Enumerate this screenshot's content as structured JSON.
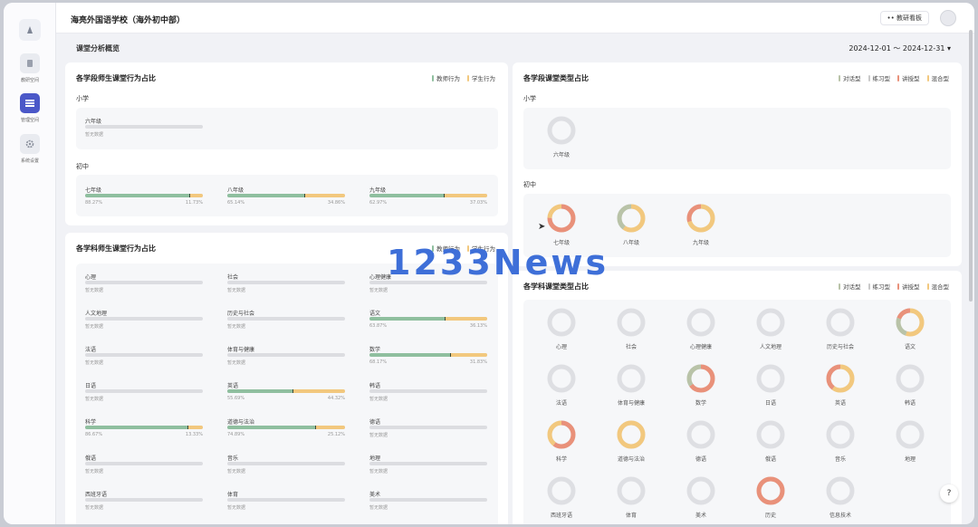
{
  "app": {
    "school_name": "海亮外国语学校（海外初中部）",
    "header_button": "教研看板",
    "page_title": "课堂分析概览",
    "date_range": "2024-12-01 ～ 2024-12-31 ▾",
    "help": "?"
  },
  "sidebar": {
    "items": [
      {
        "label": "教研空间",
        "icon": "book-icon"
      },
      {
        "label": "管理空间",
        "icon": "grid-icon",
        "active": true
      },
      {
        "label": "系统设置",
        "icon": "gear-icon"
      }
    ]
  },
  "colors": {
    "teacher": "#8fbf9f",
    "student": "#f2c87e",
    "dialog": "#b9c3a8",
    "practice": "#c9c9c9",
    "lecture": "#e9917a",
    "mixed": "#f2c87e",
    "accent": "#4b58c8"
  },
  "stage_behavior": {
    "title": "各学段师生课堂行为占比",
    "legend": {
      "teacher": "教师行为",
      "student": "学生行为"
    },
    "primary_label": "小学",
    "primary": [
      {
        "name": "六年级",
        "pct": "暂无数据"
      }
    ],
    "middle_label": "初中",
    "middle": [
      {
        "name": "七年级",
        "teacher": 88.27,
        "teacher_text": "88.27%",
        "student_text": "11.73%"
      },
      {
        "name": "八年级",
        "teacher": 65.14,
        "teacher_text": "65.14%",
        "student_text": "34.86%"
      },
      {
        "name": "九年级",
        "teacher": 62.97,
        "teacher_text": "62.97%",
        "student_text": "37.03%"
      }
    ]
  },
  "subject_behavior": {
    "title": "各学科师生课堂行为占比",
    "legend": {
      "teacher": "教师行为",
      "student": "学生行为"
    },
    "items": [
      {
        "name": "心理",
        "pct": "暂无数据"
      },
      {
        "name": "社会",
        "pct": "暂无数据"
      },
      {
        "name": "心理健康",
        "pct": "暂无数据"
      },
      {
        "name": "人文地理",
        "pct": "暂无数据"
      },
      {
        "name": "历史与社会",
        "pct": "暂无数据"
      },
      {
        "name": "语文",
        "teacher": 63.87,
        "teacher_text": "63.87%",
        "student_text": "36.13%"
      },
      {
        "name": "法语",
        "pct": "暂无数据"
      },
      {
        "name": "体育与健康",
        "pct": "暂无数据"
      },
      {
        "name": "数学",
        "teacher": 68.17,
        "teacher_text": "68.17%",
        "student_text": "31.83%"
      },
      {
        "name": "日语",
        "pct": "暂无数据"
      },
      {
        "name": "英语",
        "teacher": 55.69,
        "teacher_text": "55.69%",
        "student_text": "44.32%"
      },
      {
        "name": "韩语",
        "pct": "暂无数据"
      },
      {
        "name": "科学",
        "teacher": 86.67,
        "teacher_text": "86.67%",
        "student_text": "13.33%"
      },
      {
        "name": "道德与法治",
        "teacher": 74.89,
        "teacher_text": "74.89%",
        "student_text": "25.12%"
      },
      {
        "name": "德语",
        "pct": "暂无数据"
      },
      {
        "name": "俄语",
        "pct": "暂无数据"
      },
      {
        "name": "音乐",
        "pct": "暂无数据"
      },
      {
        "name": "地理",
        "pct": "暂无数据"
      },
      {
        "name": "西班牙语",
        "pct": "暂无数据"
      },
      {
        "name": "体育",
        "pct": "暂无数据"
      },
      {
        "name": "美术",
        "pct": "暂无数据"
      }
    ]
  },
  "stage_types": {
    "title": "各学段课堂类型占比",
    "legend": {
      "dialog": "对话型",
      "practice": "练习型",
      "lecture": "讲授型",
      "mixed": "混合型"
    },
    "primary_label": "小学",
    "primary": [
      {
        "name": "六年级",
        "segments": []
      }
    ],
    "middle_label": "初中",
    "middle": [
      {
        "name": "七年级",
        "segments": [
          {
            "type": "lecture",
            "value": 0.75
          },
          {
            "type": "mixed",
            "value": 0.25
          }
        ]
      },
      {
        "name": "八年级",
        "segments": [
          {
            "type": "mixed",
            "value": 0.6
          },
          {
            "type": "dialog",
            "value": 0.4
          }
        ]
      },
      {
        "name": "九年级",
        "segments": [
          {
            "type": "mixed",
            "value": 0.7
          },
          {
            "type": "lecture",
            "value": 0.3
          }
        ]
      }
    ]
  },
  "subject_types": {
    "title": "各学科课堂类型占比",
    "legend": {
      "dialog": "对话型",
      "practice": "练习型",
      "lecture": "讲授型",
      "mixed": "混合型"
    },
    "items": [
      {
        "name": "心理",
        "segments": []
      },
      {
        "name": "社会",
        "segments": []
      },
      {
        "name": "心理健康",
        "segments": []
      },
      {
        "name": "人文地理",
        "segments": []
      },
      {
        "name": "历史与社会",
        "segments": []
      },
      {
        "name": "语文",
        "segments": [
          {
            "type": "mixed",
            "value": 0.55
          },
          {
            "type": "dialog",
            "value": 0.25
          },
          {
            "type": "lecture",
            "value": 0.2
          }
        ]
      },
      {
        "name": "法语",
        "segments": []
      },
      {
        "name": "体育与健康",
        "segments": []
      },
      {
        "name": "数学",
        "segments": [
          {
            "type": "lecture",
            "value": 0.65
          },
          {
            "type": "dialog",
            "value": 0.35
          }
        ]
      },
      {
        "name": "日语",
        "segments": []
      },
      {
        "name": "英语",
        "segments": [
          {
            "type": "mixed",
            "value": 0.6
          },
          {
            "type": "lecture",
            "value": 0.4
          }
        ]
      },
      {
        "name": "韩语",
        "segments": []
      },
      {
        "name": "科学",
        "segments": [
          {
            "type": "lecture",
            "value": 0.6
          },
          {
            "type": "mixed",
            "value": 0.4
          }
        ]
      },
      {
        "name": "道德与法治",
        "segments": [
          {
            "type": "mixed",
            "value": 1.0
          }
        ]
      },
      {
        "name": "德语",
        "segments": []
      },
      {
        "name": "俄语",
        "segments": []
      },
      {
        "name": "音乐",
        "segments": []
      },
      {
        "name": "地理",
        "segments": []
      },
      {
        "name": "西班牙语",
        "segments": []
      },
      {
        "name": "体育",
        "segments": []
      },
      {
        "name": "美术",
        "segments": []
      },
      {
        "name": "历史",
        "segments": [
          {
            "type": "lecture",
            "value": 1.0
          }
        ]
      },
      {
        "name": "信息技术",
        "segments": []
      }
    ]
  },
  "watermark": "1233News"
}
